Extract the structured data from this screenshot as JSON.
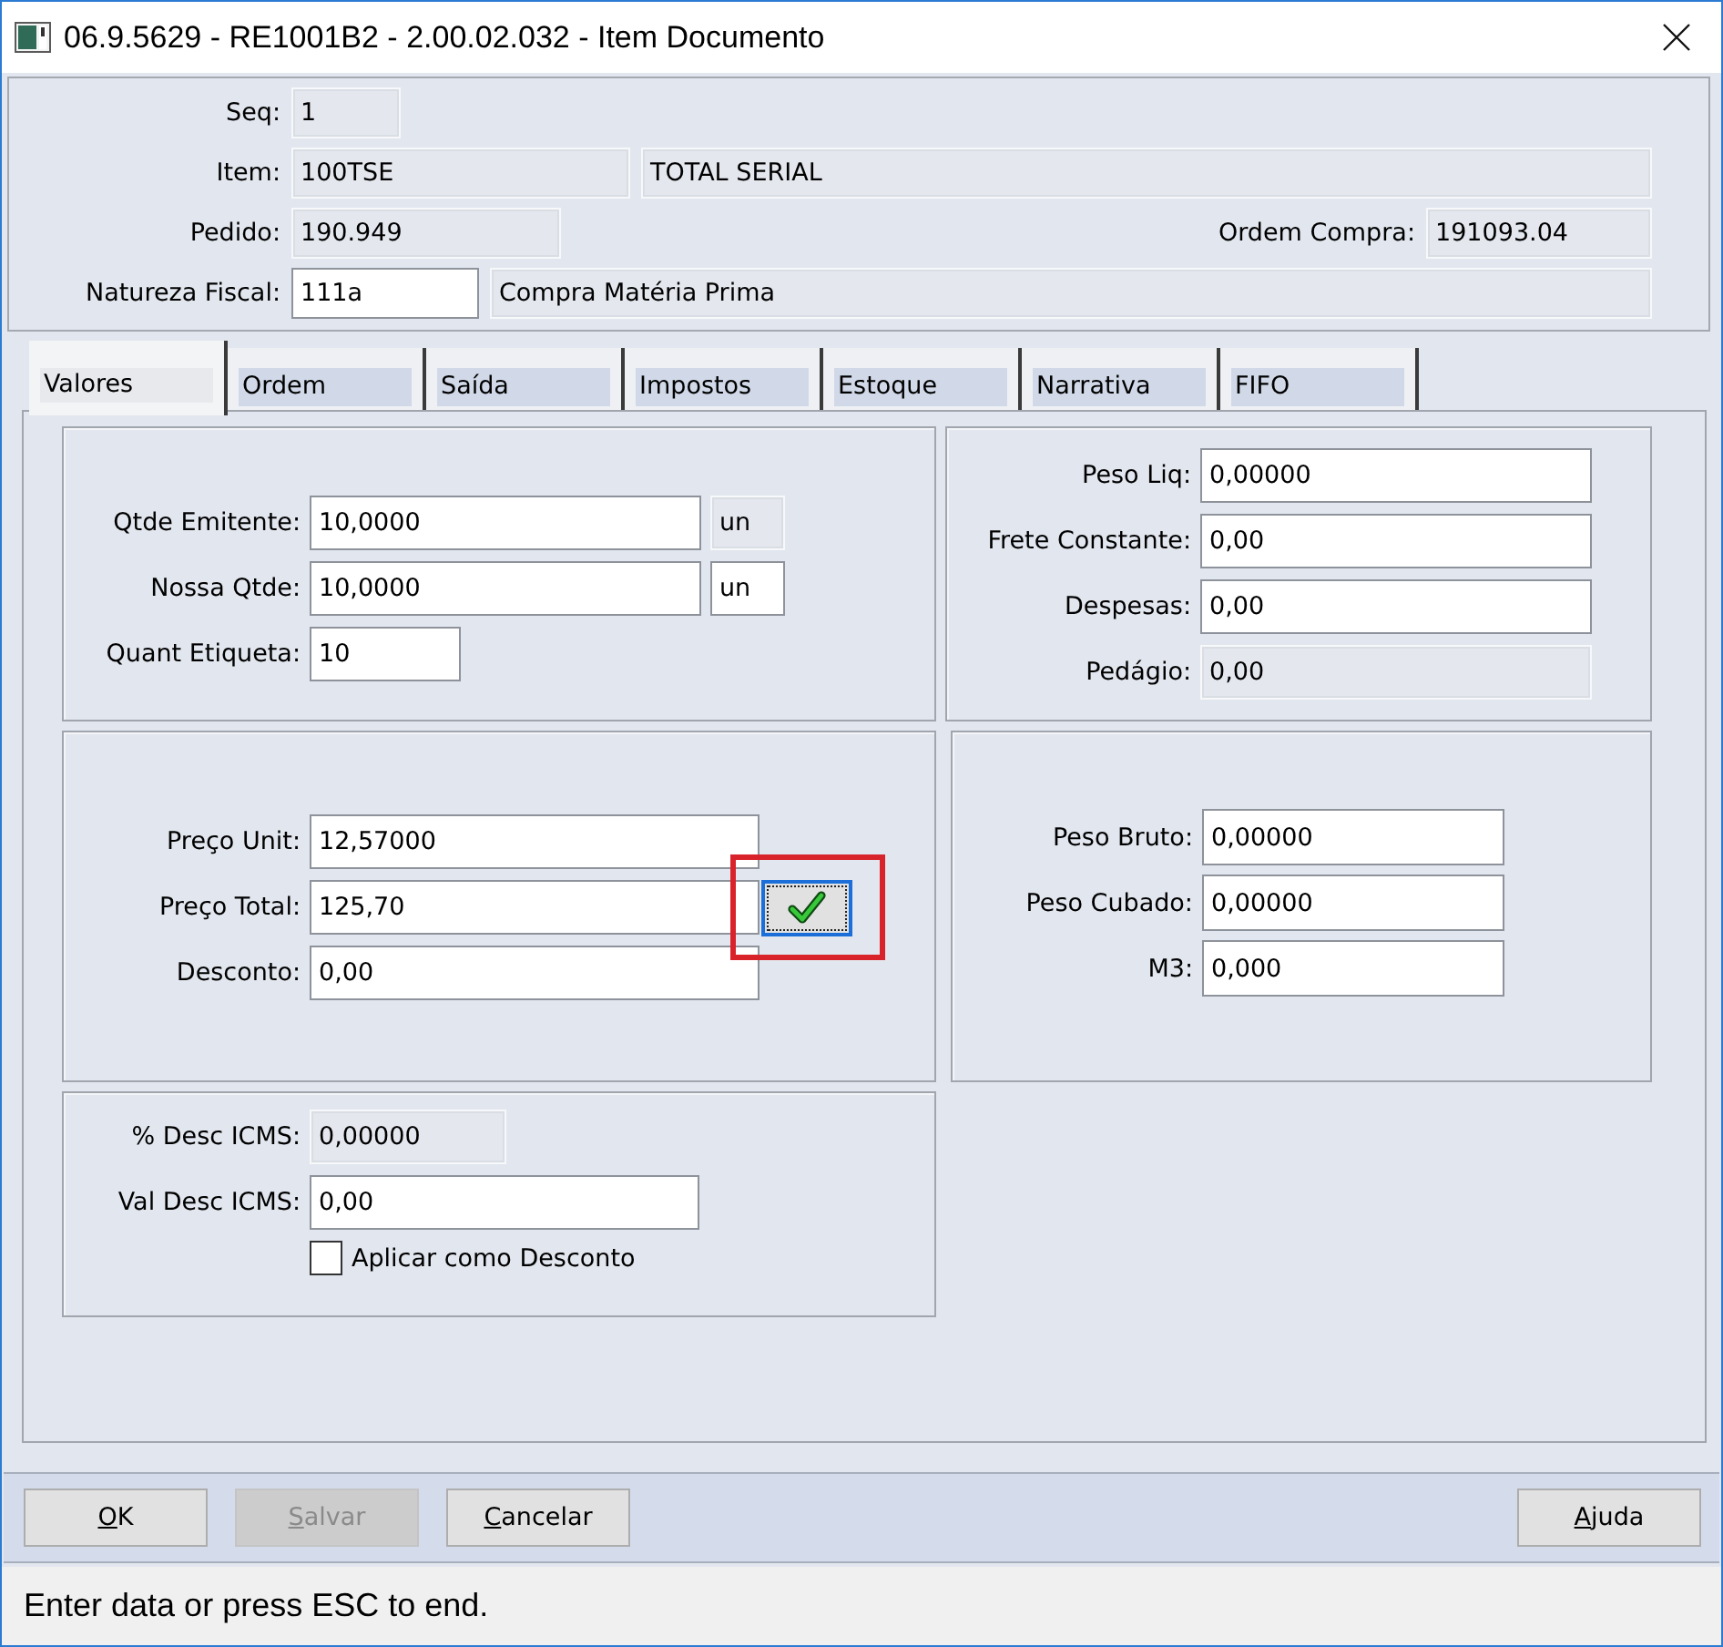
{
  "window": {
    "title": "06.9.5629 - RE1001B2 - 2.00.02.032 - Item Documento"
  },
  "header": {
    "rows": [
      [
        {
          "label": "Seq:",
          "value": "1",
          "editable": false
        }
      ],
      [
        {
          "label": "Item:",
          "value": "100TSE",
          "editable": false
        },
        {
          "value": "TOTAL SERIAL",
          "editable": false
        }
      ],
      [
        {
          "label": "Pedido:",
          "value": "190.949",
          "editable": false
        },
        {
          "label": "Ordem Compra:",
          "value": "191093.04",
          "editable": false
        }
      ],
      [
        {
          "label": "Natureza Fiscal:",
          "value": "111a",
          "editable": true
        },
        {
          "value": "Compra Matéria Prima",
          "editable": false
        }
      ]
    ]
  },
  "tabs": [
    {
      "label": "Valores",
      "selected": true
    },
    {
      "label": "Ordem",
      "selected": false
    },
    {
      "label": "Saída",
      "selected": false
    },
    {
      "label": "Impostos",
      "selected": false
    },
    {
      "label": "Estoque",
      "selected": false
    },
    {
      "label": "Narrativa",
      "selected": false
    },
    {
      "label": "FIFO",
      "selected": false
    }
  ],
  "tab_page": {
    "panels": [
      {
        "fields": [
          {
            "label": "Qtde Emitente:",
            "value": "10,0000",
            "editable": true,
            "unit": {
              "value": "un",
              "editable": false
            }
          },
          {
            "label": "Nossa Qtde:",
            "value": "10,0000",
            "editable": true,
            "unit": {
              "value": "un",
              "editable": true
            }
          },
          {
            "label": "Quant Etiqueta:",
            "value": "10",
            "editable": true
          }
        ]
      },
      {
        "fields": [
          {
            "label": "Peso Liq:",
            "value": "0,00000",
            "editable": true
          },
          {
            "label": "Frete Constante:",
            "value": "0,00",
            "editable": true
          },
          {
            "label": "Despesas:",
            "value": "0,00",
            "editable": true
          },
          {
            "label": "Pedágio:",
            "value": "0,00",
            "editable": false
          }
        ]
      },
      {
        "fields": [
          {
            "label": "Preço Unit:",
            "value": "12,57000",
            "editable": true
          },
          {
            "label": "Preço Total:",
            "value": "125,70",
            "editable": true,
            "action": {
              "kind": "confirm",
              "focused": true,
              "highlighted": true
            }
          },
          {
            "label": "Desconto:",
            "value": "0,00",
            "editable": true
          }
        ]
      },
      {
        "fields": [
          {
            "label": "Peso Bruto:",
            "value": "0,00000",
            "editable": true
          },
          {
            "label": "Peso Cubado:",
            "value": "0,00000",
            "editable": true
          },
          {
            "label": "M3:",
            "value": "0,000",
            "editable": true
          }
        ]
      },
      {
        "fields": [
          {
            "label": "% Desc ICMS:",
            "value": "0,00000",
            "editable": false
          },
          {
            "label": "Val Desc ICMS:",
            "value": "0,00",
            "editable": true
          }
        ],
        "checkbox": {
          "label": "Aplicar como Desconto",
          "checked": false
        }
      }
    ]
  },
  "buttons_left": [
    {
      "label": "OK",
      "disabled": false
    },
    {
      "label": "Salvar",
      "disabled": true
    },
    {
      "label": "Cancelar",
      "disabled": false
    }
  ],
  "buttons_right": [
    {
      "label": "Ajuda",
      "disabled": false
    }
  ],
  "status_bar": {
    "text": "Enter data or press ESC to end."
  }
}
